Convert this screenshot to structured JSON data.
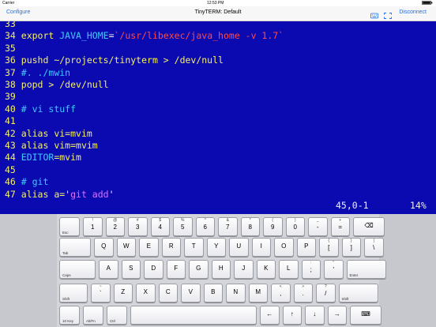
{
  "status_bar": {
    "carrier": "Carrier",
    "time": "12:53 PM"
  },
  "nav": {
    "left": "Configure",
    "title": "TinyTERM: Default",
    "right": "Disconnect",
    "icons": [
      "keyboard-icon",
      "fullscreen-icon"
    ]
  },
  "terminal": {
    "lines": [
      [
        {
          "t": "33",
          "c": "ln"
        }
      ],
      [
        {
          "t": "34 ",
          "c": "ln"
        },
        {
          "t": "export ",
          "c": "kw"
        },
        {
          "t": "JAVA_HOME",
          "c": "var"
        },
        {
          "t": "=",
          "c": "plain"
        },
        {
          "t": "`/usr/libexec/java_home -v 1.7`",
          "c": "str"
        }
      ],
      [
        {
          "t": "35",
          "c": "ln"
        }
      ],
      [
        {
          "t": "36 ",
          "c": "ln"
        },
        {
          "t": "pushd ~/projects/tinyterm > /dev/null",
          "c": "kw"
        }
      ],
      [
        {
          "t": "37 ",
          "c": "ln"
        },
        {
          "t": "#. ./mwin",
          "c": "comment"
        }
      ],
      [
        {
          "t": "38 ",
          "c": "ln"
        },
        {
          "t": "popd > /dev/null",
          "c": "kw"
        }
      ],
      [
        {
          "t": "39",
          "c": "ln"
        }
      ],
      [
        {
          "t": "40 ",
          "c": "ln"
        },
        {
          "t": "# vi stuff",
          "c": "comment"
        }
      ],
      [
        {
          "t": "41",
          "c": "ln"
        }
      ],
      [
        {
          "t": "42 ",
          "c": "ln"
        },
        {
          "t": "alias vi=mvim",
          "c": "kw"
        }
      ],
      [
        {
          "t": "43 ",
          "c": "ln"
        },
        {
          "t": "alias vim=mvim",
          "c": "kw"
        }
      ],
      [
        {
          "t": "44 ",
          "c": "ln"
        },
        {
          "t": "EDITOR",
          "c": "var"
        },
        {
          "t": "=mvim",
          "c": "kw"
        }
      ],
      [
        {
          "t": "45",
          "c": "ln"
        }
      ],
      [
        {
          "t": "46 ",
          "c": "ln"
        },
        {
          "t": "# git",
          "c": "comment"
        }
      ],
      [
        {
          "t": "47 ",
          "c": "ln"
        },
        {
          "t": "alias a=",
          "c": "kw"
        },
        {
          "t": "'",
          "c": "plain"
        },
        {
          "t": "git add",
          "c": "strm"
        },
        {
          "t": "'",
          "c": "plain"
        }
      ]
    ],
    "status_pos": "45,0-1",
    "status_pct": "14%"
  },
  "keyboard": {
    "rows": [
      [
        {
          "small": "Esc",
          "w": 26
        },
        {
          "top": "!",
          "main": "1"
        },
        {
          "top": "@",
          "main": "2"
        },
        {
          "top": "#",
          "main": "3"
        },
        {
          "top": "$",
          "main": "4"
        },
        {
          "top": "%",
          "main": "5"
        },
        {
          "top": "^",
          "main": "6"
        },
        {
          "top": "&",
          "main": "7"
        },
        {
          "top": "*",
          "main": "8"
        },
        {
          "top": "(",
          "main": "9"
        },
        {
          "top": ")",
          "main": "0"
        },
        {
          "top": "_",
          "main": "-"
        },
        {
          "top": "+",
          "main": "="
        },
        {
          "main": "⌫",
          "w": 40
        }
      ],
      [
        {
          "small": "Tab",
          "w": 40
        },
        {
          "main": "Q"
        },
        {
          "main": "W"
        },
        {
          "main": "E"
        },
        {
          "main": "R"
        },
        {
          "main": "T"
        },
        {
          "main": "Y"
        },
        {
          "main": "U"
        },
        {
          "main": "I"
        },
        {
          "main": "O"
        },
        {
          "main": "P"
        },
        {
          "top": "{",
          "main": "["
        },
        {
          "top": "}",
          "main": "]"
        },
        {
          "top": "|",
          "main": "\\"
        }
      ],
      [
        {
          "small": "Caps",
          "w": 46
        },
        {
          "main": "A"
        },
        {
          "main": "S"
        },
        {
          "main": "D"
        },
        {
          "main": "F"
        },
        {
          "main": "G"
        },
        {
          "main": "H"
        },
        {
          "main": "J"
        },
        {
          "main": "K"
        },
        {
          "main": "L"
        },
        {
          "top": ":",
          "main": ";"
        },
        {
          "top": "\"",
          "main": "'"
        },
        {
          "small": "Enter",
          "w": 50
        }
      ],
      [
        {
          "small": "Shift",
          "w": 36
        },
        {
          "top": "~",
          "main": "`"
        },
        {
          "main": "Z"
        },
        {
          "main": "X"
        },
        {
          "main": "C"
        },
        {
          "main": "V"
        },
        {
          "main": "B"
        },
        {
          "main": "N"
        },
        {
          "main": "M"
        },
        {
          "top": "<",
          "main": ","
        },
        {
          "top": ">",
          "main": "."
        },
        {
          "top": "?",
          "main": "/"
        },
        {
          "small": "Shift",
          "w": 50
        }
      ],
      [
        {
          "small": "10 Key",
          "w": 26
        },
        {
          "small": "Alt/Fn",
          "w": 26
        },
        {
          "small": "Ctrl",
          "w": 26
        },
        {
          "main": "",
          "w": 160
        },
        {
          "main": "←"
        },
        {
          "main": "↑"
        },
        {
          "main": "↓"
        },
        {
          "main": "→"
        },
        {
          "main": "⌨",
          "w": 40
        }
      ]
    ]
  },
  "colors": {
    "terminal_bg": "#0a0ab0",
    "nav_accent": "#1a73e8"
  }
}
